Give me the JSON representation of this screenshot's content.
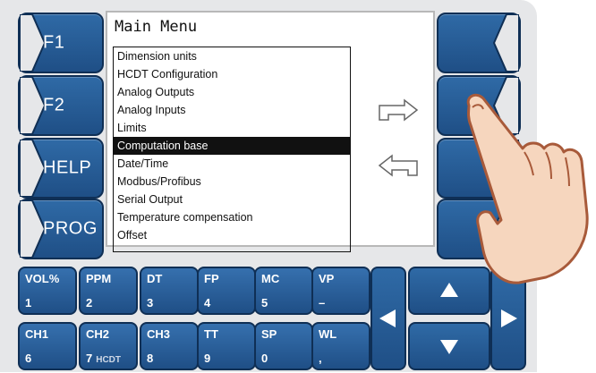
{
  "screen": {
    "title": "Main Menu",
    "menu_items": [
      "Dimension units",
      "HCDT Configuration",
      "Analog Outputs",
      "Analog Inputs",
      "Limits",
      "Computation base",
      "Date/Time",
      "Modbus/Profibus",
      "Serial Output",
      "Temperature compensation",
      "Offset"
    ],
    "selected_index": 5
  },
  "left_keys": [
    "F1",
    "F2",
    "HELP",
    "PROG"
  ],
  "keypad": {
    "row1": [
      {
        "top": "VOL%",
        "bottom": "1"
      },
      {
        "top": "PPM",
        "bottom": "2"
      },
      {
        "top": "DT",
        "bottom": "3"
      },
      {
        "top": "FP",
        "bottom": "4"
      },
      {
        "top": "MC",
        "bottom": "5"
      },
      {
        "top": "VP",
        "bottom": "–"
      }
    ],
    "row2": [
      {
        "top": "CH1",
        "bottom": "6"
      },
      {
        "top": "CH2",
        "bottom": "7",
        "extra": "HCDT"
      },
      {
        "top": "CH3",
        "bottom": "8"
      },
      {
        "top": "TT",
        "bottom": "9"
      },
      {
        "top": "SP",
        "bottom": "0"
      },
      {
        "top": "WL",
        "bottom": ","
      }
    ]
  }
}
